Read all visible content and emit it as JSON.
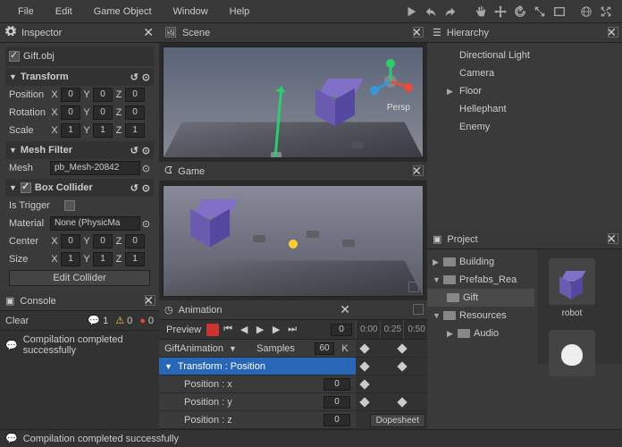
{
  "menubar": {
    "items": [
      "File",
      "Edit",
      "Game Object",
      "Window",
      "Help"
    ]
  },
  "inspector": {
    "title": "Inspector",
    "object_name": "Gift.obj",
    "transform": {
      "title": "Transform",
      "position": {
        "label": "Position",
        "x": "0",
        "y": "0",
        "z": "0"
      },
      "rotation": {
        "label": "Rotation",
        "x": "0",
        "y": "0",
        "z": "0"
      },
      "scale": {
        "label": "Scale",
        "x": "1",
        "y": "1",
        "z": "1"
      }
    },
    "mesh_filter": {
      "title": "Mesh Filter",
      "mesh_label": "Mesh",
      "mesh_value": "pb_Mesh-20842"
    },
    "box_collider": {
      "title": "Box Collider",
      "is_trigger_label": "Is Trigger",
      "material_label": "Material",
      "material_value": "None (PhysicMa",
      "center": {
        "label": "Center",
        "x": "0",
        "y": "0",
        "z": "0"
      },
      "size": {
        "label": "Size",
        "x": "1",
        "y": "1",
        "z": "1"
      },
      "edit_btn": "Edit Collider"
    }
  },
  "scene": {
    "title": "Scene",
    "persp_label": "Persp"
  },
  "game": {
    "title": "Game"
  },
  "hierarchy": {
    "title": "Hierarchy",
    "items": [
      {
        "label": "Directional Light",
        "arrow": false
      },
      {
        "label": "Camera",
        "arrow": false
      },
      {
        "label": "Floor",
        "arrow": true
      },
      {
        "label": "Hellephant",
        "arrow": false
      },
      {
        "label": "Enemy",
        "arrow": false
      }
    ]
  },
  "project": {
    "title": "Project",
    "tree": [
      {
        "label": "Building",
        "indent": 1,
        "expanded": false
      },
      {
        "label": "Prefabs_Rea",
        "indent": 1,
        "expanded": true
      },
      {
        "label": "Gift",
        "indent": 2,
        "selected": true
      },
      {
        "label": "Resources",
        "indent": 1,
        "expanded": true
      },
      {
        "label": "Audio",
        "indent": 2,
        "expanded": false
      }
    ],
    "thumbs": [
      {
        "label": "robot"
      }
    ]
  },
  "console": {
    "title": "Console",
    "clear_btn": "Clear",
    "info_count": "1",
    "warn_count": "0",
    "error_count": "0",
    "message": "Compilation completed successfully"
  },
  "animation": {
    "title": "Animation",
    "preview_btn": "Preview",
    "frame": "0",
    "clip_name": "GiftAnimation",
    "samples_label": "Samples",
    "samples_value": "60",
    "keytype": "K",
    "track_header": "Transform : Position",
    "tracks": [
      {
        "label": "Position : x",
        "value": "0"
      },
      {
        "label": "Position : y",
        "value": "0"
      },
      {
        "label": "Position : z",
        "value": "0"
      }
    ],
    "dopesheet_btn": "Dopesheet",
    "ruler": [
      "0:00",
      "0:25",
      "0:50"
    ]
  },
  "statusbar": {
    "message": "Compilation completed successfully"
  }
}
